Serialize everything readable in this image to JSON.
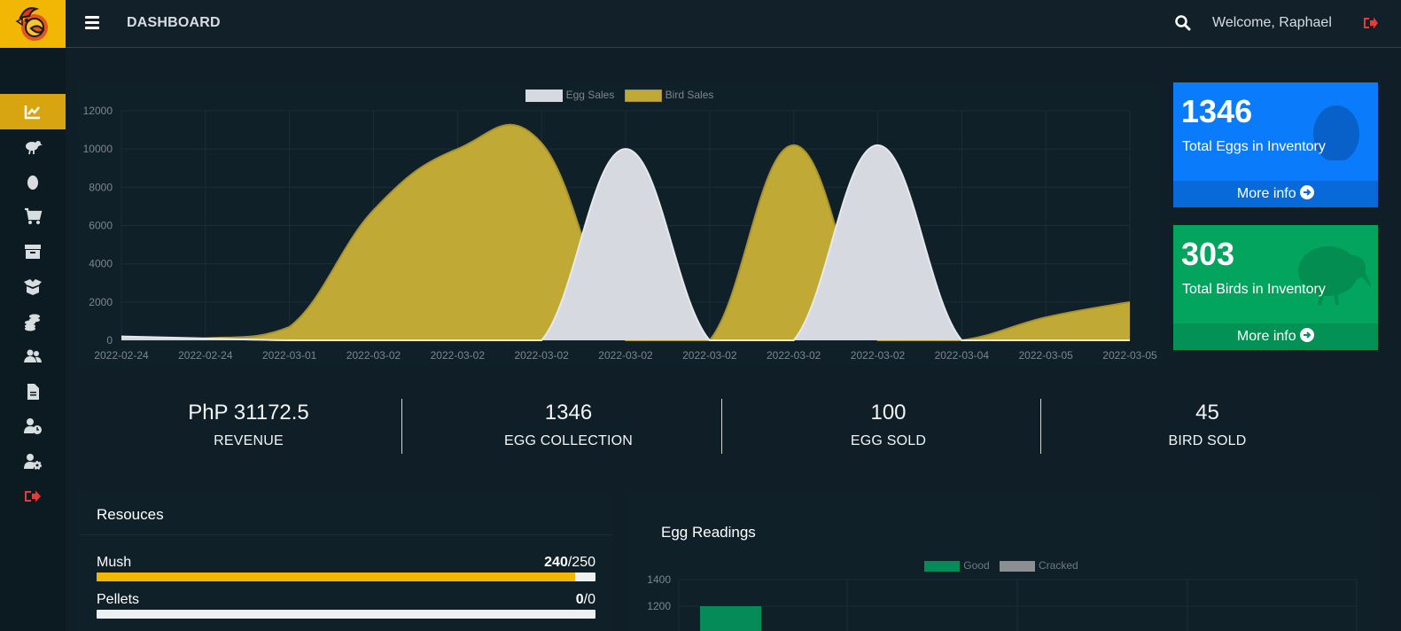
{
  "header": {
    "title": "DASHBOARD",
    "welcome": "Welcome, Raphael"
  },
  "sidebar": {
    "items": [
      {
        "icon": "chart-line-icon",
        "active": true
      },
      {
        "icon": "bird-icon"
      },
      {
        "icon": "egg-icon"
      },
      {
        "icon": "cart-icon"
      },
      {
        "icon": "archive-icon"
      },
      {
        "icon": "box-open-icon"
      },
      {
        "icon": "coins-icon"
      },
      {
        "icon": "users-icon"
      },
      {
        "icon": "file-icon"
      },
      {
        "icon": "user-clock-icon"
      },
      {
        "icon": "user-gear-icon"
      },
      {
        "icon": "logout-icon"
      }
    ]
  },
  "colors": {
    "accent": "#f2b705",
    "egg_sales": "#d6dae0",
    "bird_sales": "#c0a935",
    "blue_box": "#0a7bfb",
    "green_box": "#03a45e",
    "good": "#048b57",
    "cracked": "#8c8f92"
  },
  "info_boxes": [
    {
      "value": "1346",
      "label": "Total Eggs in Inventory",
      "footer": "More info"
    },
    {
      "value": "303",
      "label": "Total Birds in Inventory",
      "footer": "More info"
    }
  ],
  "stats": [
    {
      "value": "PhP 31172.5",
      "label": "REVENUE"
    },
    {
      "value": "1346",
      "label": "EGG COLLECTION"
    },
    {
      "value": "100",
      "label": "EGG SOLD"
    },
    {
      "value": "45",
      "label": "BIRD SOLD"
    }
  ],
  "resources": {
    "title": "Resouces",
    "items": [
      {
        "name": "Mush",
        "current": "240",
        "total": "/250",
        "fraction": 0.96
      },
      {
        "name": "Pellets",
        "current": "0",
        "total": "/0",
        "fraction": 0
      }
    ]
  },
  "egg_readings": {
    "title": "Egg Readings"
  },
  "chart_data": [
    {
      "type": "area",
      "categories": [
        "2022-02-24",
        "2022-02-24",
        "2022-03-01",
        "2022-03-02",
        "2022-03-02",
        "2022-03-02",
        "2022-03-02",
        "2022-03-02",
        "2022-03-02",
        "2022-03-02",
        "2022-03-04",
        "2022-03-05",
        "2022-03-05"
      ],
      "series": [
        {
          "name": "Egg Sales",
          "values": [
            200,
            100,
            0,
            0,
            0,
            0,
            10000,
            0,
            0,
            10200,
            0,
            0,
            0
          ]
        },
        {
          "name": "Bird Sales",
          "values": [
            100,
            100,
            700,
            6800,
            10000,
            10300,
            0,
            0,
            10200,
            0,
            0,
            1200,
            2000
          ]
        }
      ],
      "ylim": [
        0,
        12000
      ],
      "yticks": [
        "12000",
        "10000",
        "8000",
        "6000",
        "4000",
        "2000",
        "0"
      ],
      "grid": true,
      "legend": "top-center"
    },
    {
      "type": "bar",
      "series": [
        {
          "name": "Good",
          "values": [
            1200
          ]
        },
        {
          "name": "Cracked",
          "values": []
        }
      ],
      "yticks": [
        "1400",
        "1200"
      ],
      "legend": "top-center"
    }
  ]
}
